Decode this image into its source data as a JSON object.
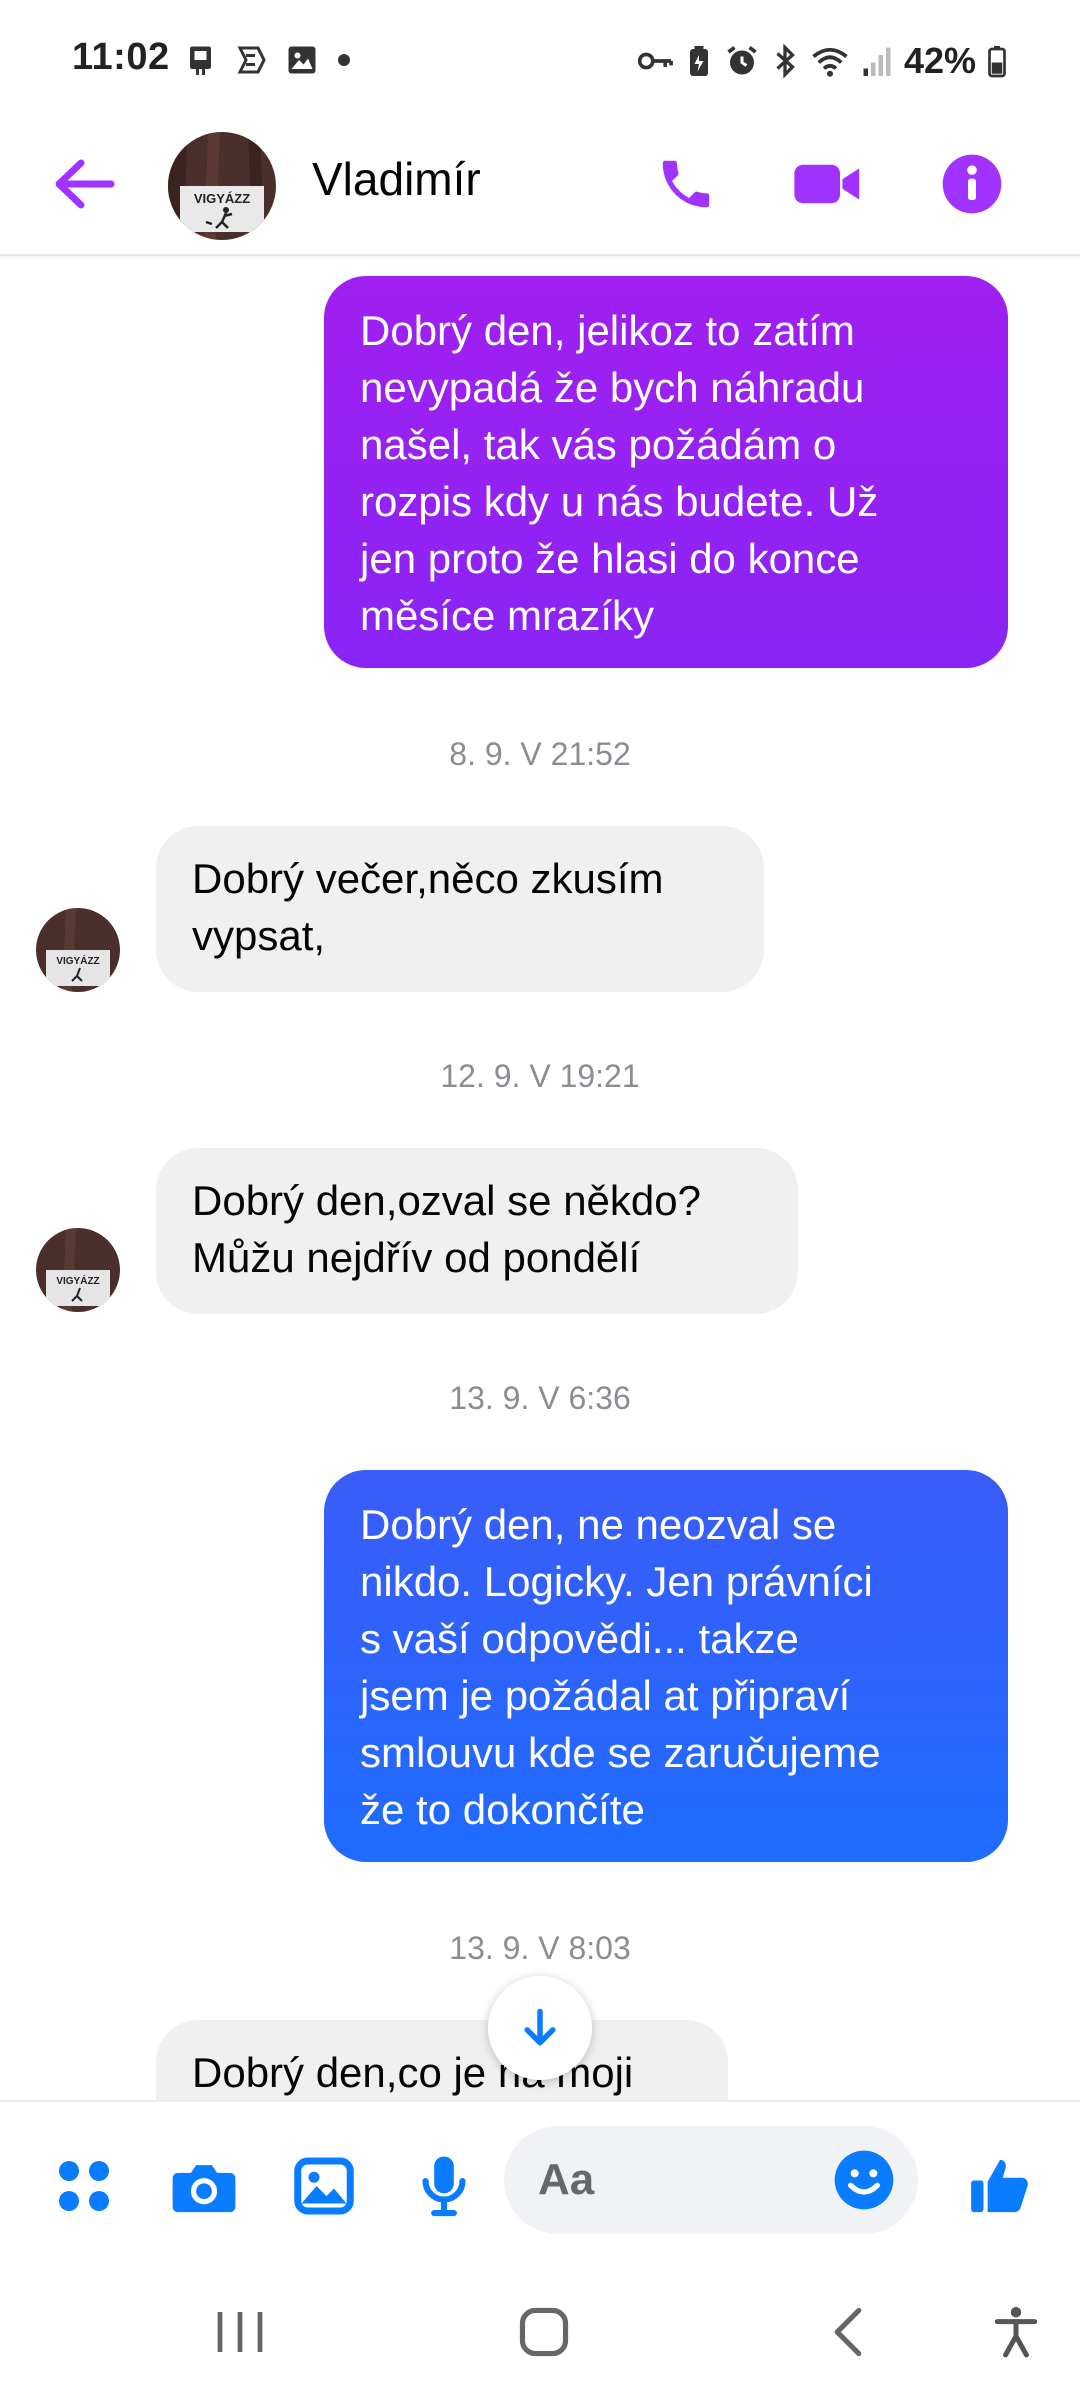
{
  "status_bar": {
    "time": "11:02",
    "battery_percent": "42%",
    "left_icons": [
      "sim-icon",
      "messenger-status-icon",
      "gallery-icon",
      "dot"
    ],
    "right_icons": [
      "key-icon",
      "battery-saver-icon",
      "alarm-icon",
      "bluetooth-icon",
      "wifi-icon",
      "signal-icon",
      "battery-icon"
    ]
  },
  "header": {
    "contact_name": "Vladimír",
    "avatar_text": "VIGYÁZZ",
    "actions": [
      "phone-icon",
      "video-icon",
      "info-icon"
    ],
    "accent_color": "#a033ff"
  },
  "conversation": {
    "messages": [
      {
        "direction": "outgoing",
        "lines": [
          "Dobrý den, jelikoz to zatím",
          "nevypadá že bych náhradu",
          "našel,  tak vás požádám o",
          "rozpis kdy u nás budete. Už",
          "jen proto že hlasi do konce",
          "měsíce mrazíky"
        ]
      },
      {
        "type": "timestamp",
        "text": "8. 9. V 21:52"
      },
      {
        "direction": "incoming",
        "lines": [
          "Dobrý večer,něco zkusím",
          "vypsat,"
        ]
      },
      {
        "type": "timestamp",
        "text": "12. 9. V 19:21"
      },
      {
        "direction": "incoming",
        "lines": [
          "Dobrý den,ozval se někdo?",
          "Můžu nejdřív od pondělí"
        ]
      },
      {
        "type": "timestamp",
        "text": "13. 9. V 6:36"
      },
      {
        "direction": "outgoing",
        "lines": [
          "Dobrý den,  ne neozval se",
          "nikdo. Logicky. Jen právníci",
          "s vaší odpovědi... takze",
          "jsem je požádal at připraví",
          "smlouvu kde se zaručujeme",
          "že to dokončíte"
        ]
      },
      {
        "type": "timestamp",
        "text": "13. 9. V 8:03"
      },
      {
        "direction": "incoming",
        "lines": [
          "Dobrý den,co je na moji"
        ]
      }
    ],
    "bubble_colors": {
      "outgoing_top": "#a020f0",
      "outgoing_mid": "#5b3cf5",
      "outgoing_bottom": "#1f6bff",
      "incoming": "#f0f0f0"
    }
  },
  "composer": {
    "placeholder": "Aa",
    "icons": [
      "apps-icon",
      "camera-icon",
      "gallery-icon",
      "microphone-icon",
      "emoji-icon",
      "thumbs-up-icon"
    ],
    "icon_color": "#0a7cff"
  },
  "nav_bar": {
    "icons": [
      "recents-icon",
      "home-icon",
      "back-icon",
      "accessibility-icon"
    ]
  }
}
